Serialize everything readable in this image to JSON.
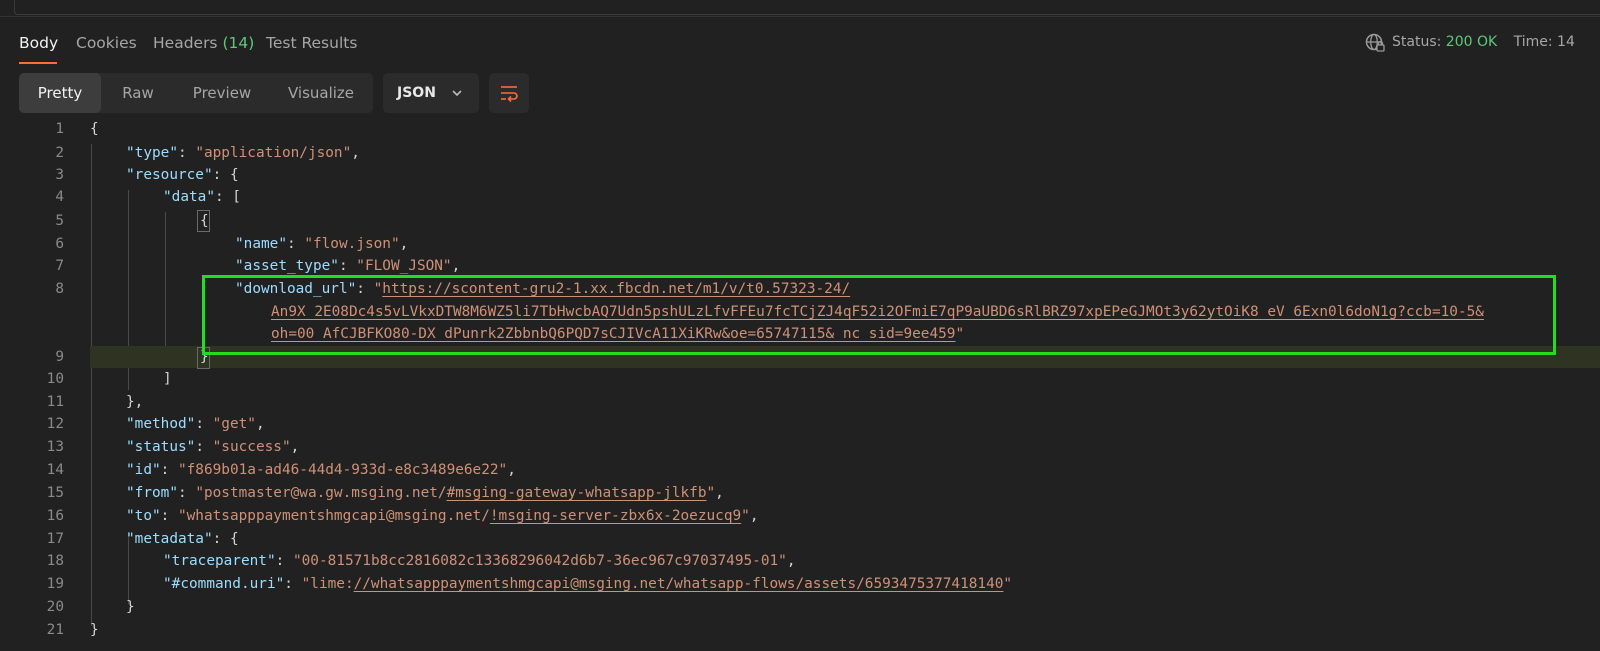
{
  "tabs": [
    {
      "label": "Body"
    },
    {
      "label": "Cookies"
    },
    {
      "label": "Headers",
      "count": "(14)"
    },
    {
      "label": "Test Results"
    }
  ],
  "status": {
    "label": "Status:",
    "value": "200 OK",
    "time_label": "Time: 14"
  },
  "view_modes": [
    "Pretty",
    "Raw",
    "Preview",
    "Visualize"
  ],
  "format": {
    "selected": "JSON"
  },
  "colors": {
    "accent": "#ff6c37",
    "success": "#5fc77a",
    "highlight_border": "#22dd22"
  },
  "code_lines": [
    {
      "n": "1"
    },
    {
      "n": "2",
      "key": "\"type\"",
      "val": "\"application/json\""
    },
    {
      "n": "3",
      "key": "\"resource\""
    },
    {
      "n": "4",
      "key": "\"data\""
    },
    {
      "n": "5"
    },
    {
      "n": "6",
      "key": "\"name\"",
      "val": "\"flow.json\""
    },
    {
      "n": "7",
      "key": "\"asset_type\"",
      "val": "\"FLOW_JSON\""
    },
    {
      "n": "8",
      "key": "\"download_url\"",
      "url1": "https://scontent-gru2-1.xx.fbcdn.net/m1/v/t0.57323-24/",
      "url2": "An9X_2E08Dc4s5vLVkxDTW8M6WZ5li7TbHwcbAQ7Udn5pshULzLfvFFEu7fcTCjZJ4qF52i2OFmiE7qP9aUBD6sRlBRZ97xpEPeGJMOt3y62ytOiK8_eV_6Exn0l6doN1g?ccb=10-5&",
      "url3": "oh=00_AfCJBFKO80-DX_dPunrk2ZbbnbQ6PQD7sCJIVcA11XiKRw&oe=65747115&_nc_sid=9ee459"
    },
    {
      "n": "9"
    },
    {
      "n": "10"
    },
    {
      "n": "11"
    },
    {
      "n": "12",
      "key": "\"method\"",
      "val": "\"get\""
    },
    {
      "n": "13",
      "key": "\"status\"",
      "val": "\"success\""
    },
    {
      "n": "14",
      "key": "\"id\"",
      "val": "\"f869b01a-ad46-44d4-933d-e8c3489e6e22\""
    },
    {
      "n": "15",
      "key": "\"from\"",
      "pre": "\"postmaster@wa.gw.msging.net/",
      "link": "#msging-gateway-whatsapp-jlkfb",
      "post": "\""
    },
    {
      "n": "16",
      "key": "\"to\"",
      "pre": "\"whatsapppaymentshmgcapi@msging.net/",
      "link": "!msging-server-zbx6x-2oezucq9",
      "post": "\""
    },
    {
      "n": "17",
      "key": "\"metadata\""
    },
    {
      "n": "18",
      "key": "\"traceparent\"",
      "val": "\"00-81571b8cc2816082c13368296042d6b7-36ec967c97037495-01\""
    },
    {
      "n": "19",
      "key": "\"#command.uri\"",
      "pre": "\"lime:",
      "link": "//whatsapppaymentshmgcapi@msging.net/whatsapp-flows/assets/6593475377418140",
      "post": "\""
    },
    {
      "n": "20"
    },
    {
      "n": "21"
    }
  ]
}
